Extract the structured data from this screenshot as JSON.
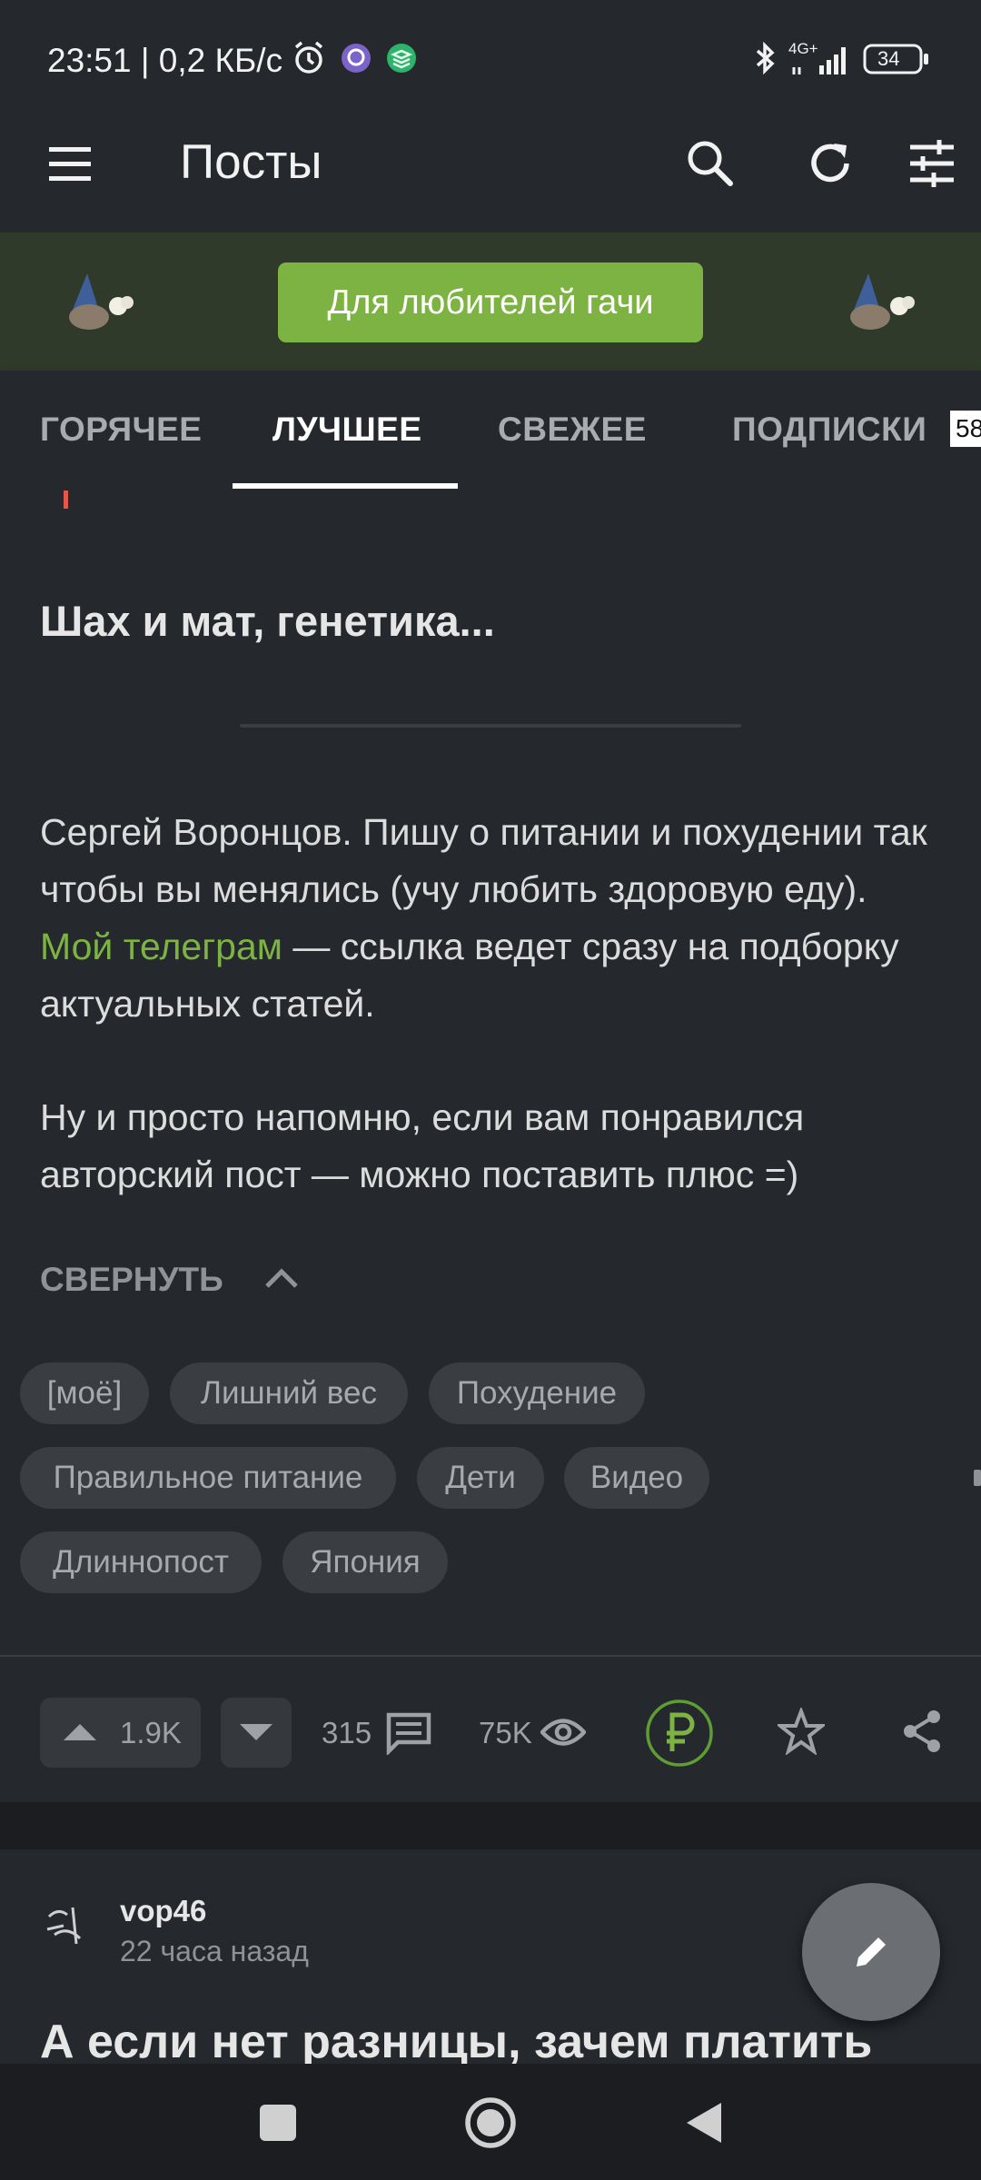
{
  "status_bar": {
    "time_text": "23:51 | 0,2 КБ/с",
    "network": "4G+",
    "battery": "34",
    "icons": [
      "alarm-icon",
      "viber-icon",
      "stack-app-icon",
      "bluetooth-icon",
      "signal-icon",
      "battery-icon"
    ]
  },
  "app_bar": {
    "title": "Посты",
    "icons": [
      "menu-icon",
      "search-icon",
      "refresh-icon",
      "filter-icon"
    ]
  },
  "banner": {
    "button_label": "Для любителей гачи",
    "icons": [
      "cat-wizard-icon",
      "cat-wizard-icon"
    ]
  },
  "tabs": {
    "items": [
      {
        "label": "ГОРЯЧЕЕ"
      },
      {
        "label": "ЛУЧШЕЕ",
        "active": true
      },
      {
        "label": "СВЕЖЕЕ"
      },
      {
        "label": "ПОДПИСКИ"
      }
    ],
    "subscriptions_badge": "58"
  },
  "post": {
    "title": "Шах и мат, генетика...",
    "paragraph1_start": "Сергей Воронцов. Пишу о питании и похудении так чтобы вы менялись (учу любить здоровую еду). ",
    "paragraph1_link": "Мой телеграм",
    "paragraph1_end": " — ссылка ведет сразу на подборку актуальных статей.",
    "paragraph2": "Ну и просто напомню, если вам понравился авторский пост — можно поставить плюс =)",
    "collapse_label": "СВЕРНУТЬ",
    "tags": [
      "[моё]",
      "Лишний вес",
      "Похудение",
      "Правильное питание",
      "Дети",
      "Видео",
      "Длиннопост",
      "Япония"
    ],
    "upvotes": "1.9K",
    "comments": "315",
    "views": "75K",
    "accent_color": "#7cb342"
  },
  "next_post": {
    "author": "vop46",
    "time_ago": "22 часа назад",
    "title": "А если нет разницы, зачем платить"
  },
  "nav_bar": {
    "icons": [
      "recents-icon",
      "home-icon",
      "back-icon"
    ]
  }
}
